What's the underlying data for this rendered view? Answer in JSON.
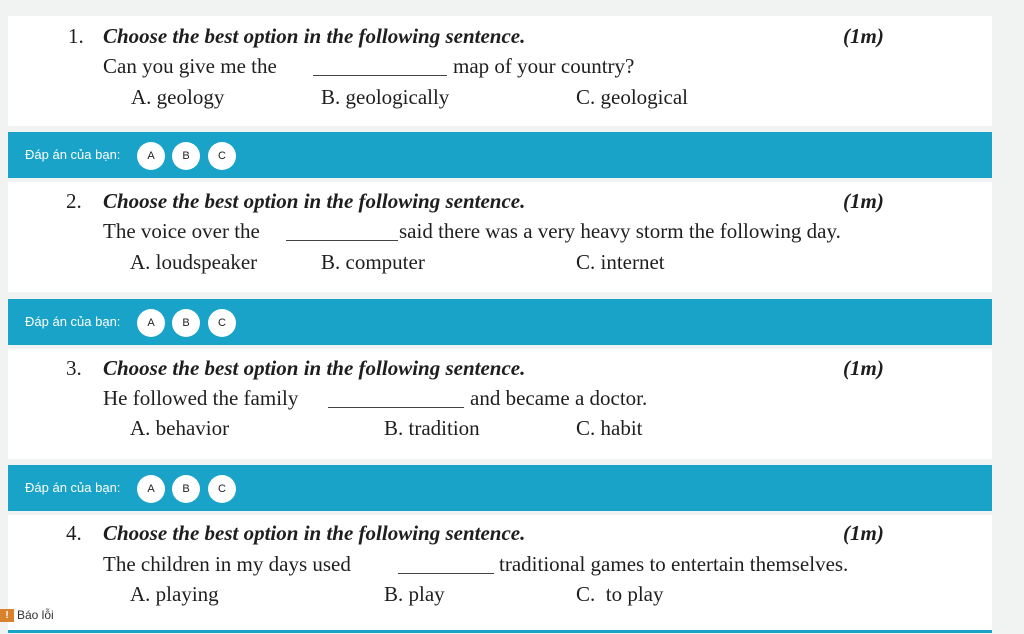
{
  "answer_label": "Đáp án của bạn:",
  "answer_options": [
    "A",
    "B",
    "C"
  ],
  "report_label": "Báo lỗi",
  "questions": [
    {
      "number": "1.",
      "instruction": "Choose the best option in the following sentence.",
      "points": "(1m)",
      "sentence_before": "Can you give me the",
      "sentence_after": "map of your country?",
      "options": [
        "A. geology",
        "B. geologically",
        "C. geological"
      ]
    },
    {
      "number": "2.",
      "instruction": "Choose the best option in the following sentence.",
      "points": "(1m)",
      "sentence_before": "The voice over the",
      "sentence_after": "said there was a very heavy storm the following day.",
      "options": [
        "A. loudspeaker",
        "B. computer",
        "C. internet"
      ]
    },
    {
      "number": "3.",
      "instruction": "Choose the best option in the following sentence.",
      "points": "(1m)",
      "sentence_before": "He followed the family",
      "sentence_after": "and became a doctor.",
      "options": [
        "A. behavior",
        "B. tradition",
        "C. habit"
      ]
    },
    {
      "number": "4.",
      "instruction": "Choose the best option in the following sentence.",
      "points": "(1m)",
      "sentence_before": "The children in my days used",
      "sentence_after": "traditional games to entertain themselves.",
      "options": [
        "A. playing",
        "B. play",
        "C.  to play"
      ]
    }
  ]
}
